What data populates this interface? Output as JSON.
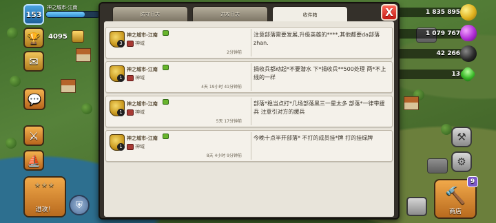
{
  "player": {
    "level": "153",
    "name": "神之城市-江南",
    "exp_fraction": 0.72,
    "trophies": "4095"
  },
  "resources": {
    "gold": "1 835 895",
    "elixir": "1 079 767",
    "dark_elixir": "42 266",
    "gems": "13"
  },
  "buttons": {
    "attack_label": "进攻！",
    "shop_label": "商店",
    "shop_badge": "9"
  },
  "modal": {
    "tabs": [
      {
        "label": "防守日志",
        "active": false
      },
      {
        "label": "进攻日志",
        "active": false
      },
      {
        "label": "收件箱",
        "active": true
      }
    ],
    "close_label": "X"
  },
  "messages": [
    {
      "sender": "神之城市-江南",
      "rank": "3",
      "role": "神域",
      "time": "2分钟前",
      "body": "注意部落需要发展,升级英雄的****,其他都要da部落zhan."
    },
    {
      "sender": "神之城市-江南",
      "rank": "1",
      "role": "神域",
      "time": "4天 19小时 41分钟前",
      "body": "捐收兵都动起*不要潜水 下*捐收兵**500处理 两*不上线的一样"
    },
    {
      "sender": "神之城市-江南",
      "rank": "1",
      "role": "神域",
      "time": "5天 17分钟前",
      "body": "部落*稳当点打*几场部落黑三一星太多    部落*一律带援兵 注意引对方的援兵"
    },
    {
      "sender": "神之城市-江南",
      "rank": "1",
      "role": "神域",
      "time": "8天 4小时 9分钟前",
      "body": "今晚十点半开部落* 不打的成员挂*牌 打的挂绿牌"
    }
  ],
  "colors": {
    "accent_close": "#d92a1c",
    "panel": "#e8e4da",
    "modal_frame": "#34302a"
  }
}
